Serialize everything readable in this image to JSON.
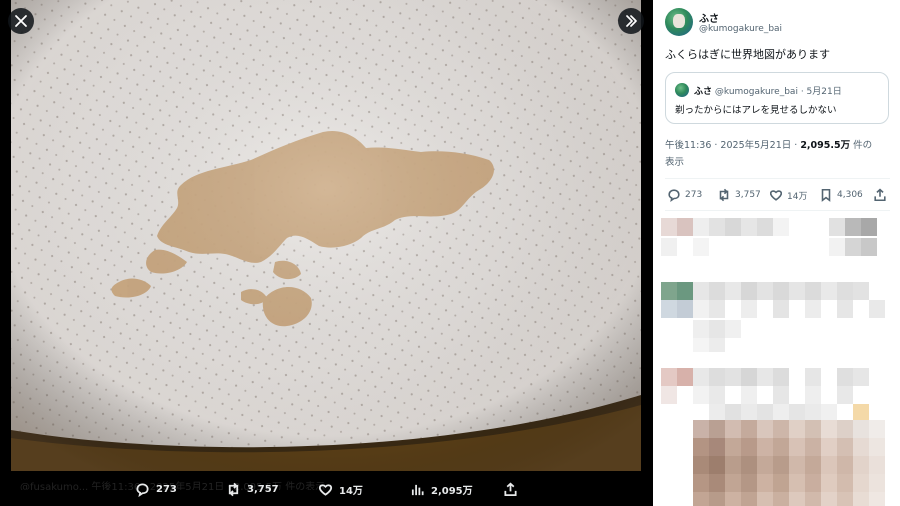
{
  "viewer": {
    "bar_ghost_text": "@fusakumo... 午後11:36 · 2025年5月21日 · 2,095.5万 件の表示",
    "actions": {
      "replies": "273",
      "reposts": "3,757",
      "likes": "14万",
      "views": "2,095万"
    }
  },
  "tweet": {
    "author": {
      "display_name": "ふさ",
      "handle": "@kumogakure_bai"
    },
    "more_label": "···",
    "text": "ふくらはぎに世界地図があります",
    "quote": {
      "name": "ふさ",
      "handle": "@kumogakure_bai",
      "date": "· 5月21日",
      "text": "剃ったからにはアレを見せるしかない"
    },
    "meta": {
      "time_date": "午後11:36 · 2025年5月21日 · ",
      "views_count": "2,095.5万",
      "views_suffix": " 件の",
      "views_suffix_2": "表示"
    },
    "actions": {
      "replies": "273",
      "reposts": "3,757",
      "likes": "14万",
      "bookmarks": "4,306"
    }
  },
  "colors": {
    "viewer_bg": "#000000",
    "panel_bg": "#ffffff",
    "text_primary": "#0f1419",
    "text_secondary": "#536471",
    "border": "#cfd9de",
    "birthmark": "#c9a67e"
  },
  "icons": [
    "close-icon",
    "expand-icon",
    "reply-icon",
    "repost-icon",
    "like-icon",
    "views-icon",
    "share-icon",
    "bookmark-icon",
    "more-icon"
  ]
}
